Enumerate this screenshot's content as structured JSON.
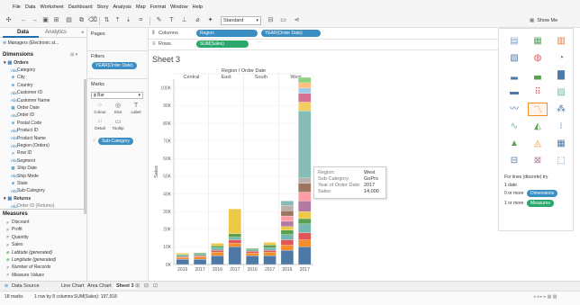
{
  "menu": [
    "File",
    "Data",
    "Worksheet",
    "Dashboard",
    "Story",
    "Analysis",
    "Map",
    "Format",
    "Window",
    "Help"
  ],
  "toolbar": {
    "fit": "Standard",
    "show_me": "Show Me"
  },
  "left_pane": {
    "tabs": [
      "Data",
      "Analytics"
    ],
    "datasource": "Managers (Electronic st...",
    "dimensions_header": "Dimensions",
    "orders_folder": "Orders",
    "dimensions": [
      "Category",
      "City",
      "Country",
      "Customer ID",
      "Customer Name",
      "Order Date",
      "Order ID",
      "Postal Code",
      "Product ID",
      "Product Name",
      "Region (Orders)",
      "Row ID",
      "Segment",
      "Ship Date",
      "Ship Mode",
      "State",
      "Sub-Category"
    ],
    "returns_folder": "Returns",
    "returns_field": "Order ID (Returns)",
    "measures_header": "Measures",
    "measures": [
      "Discount",
      "Profit",
      "Quantity",
      "Sales",
      "Latitude (generated)",
      "Longitude (generated)",
      "Number of Records",
      "Measure Values"
    ]
  },
  "mid_pane": {
    "pages": "Pages",
    "filters": "Filters",
    "filter_pill": "YEAR(Order Date)",
    "marks": "Marks",
    "mark_type": "Bar",
    "mark_buttons": [
      "Colour",
      "Size",
      "Label",
      "Detail",
      "Tooltip"
    ],
    "color_pill": "Sub-Category"
  },
  "shelves": {
    "columns_label": "Columns",
    "rows_label": "Rows",
    "columns_pills": [
      "Region",
      "YEAR(Order Date)"
    ],
    "rows_pills": [
      "SUM(Sales)"
    ]
  },
  "sheet_title": "Sheet 3",
  "tooltip": [
    {
      "key": "Region:",
      "value": "West"
    },
    {
      "key": "Sub-Category:",
      "value": "GoPro"
    },
    {
      "key": "Year of Order Date:",
      "value": "2017"
    },
    {
      "key": "Sales:",
      "value": "14,000"
    }
  ],
  "bottom_tabs": [
    "Data Source",
    "Line Chart",
    "Area Chart",
    "Sheet 3"
  ],
  "status": {
    "marks": "18 marks",
    "rows_cols": "1 row by 8 columns",
    "sum": "SUM(Sales): 197,918"
  },
  "showme": {
    "for_text": "For lines (discrete) try",
    "line1": "1 date",
    "line2": "0 or more",
    "dim_pill": "Dimensions",
    "line3": "1 or more",
    "mea_pill": "Measures"
  },
  "colors": {
    "accent": "#1f6fb0",
    "pill_blue": "#3a8ec4",
    "pill_green": "#2aa86c",
    "palette": [
      "#4e79a7",
      "#f28e2b",
      "#e15759",
      "#76b7b2",
      "#59a14f",
      "#edc948",
      "#b07aa1",
      "#ff9da7",
      "#9c755f",
      "#bab0ac",
      "#86bcb6",
      "#f1ce63",
      "#d37295",
      "#a0cbe8",
      "#ffbe7d",
      "#8cd17d",
      "#499894"
    ]
  },
  "chart_data": {
    "type": "bar",
    "title": "Region / Order Date",
    "ylabel": "Sales",
    "ylim": [
      0,
      105000
    ],
    "yticks": [
      0,
      10000,
      20000,
      30000,
      40000,
      50000,
      60000,
      70000,
      80000,
      90000,
      100000
    ],
    "ytick_labels": [
      "0K",
      "10K",
      "20K",
      "30K",
      "40K",
      "50K",
      "60K",
      "70K",
      "80K",
      "90K",
      "100K"
    ],
    "regions": [
      "Central",
      "East",
      "South",
      "West"
    ],
    "categories": [
      "2016",
      "2017",
      "2016",
      "2017",
      "2016",
      "2017",
      "2016",
      "2017"
    ],
    "bars": [
      {
        "region": "Central",
        "year": "2016",
        "segments": [
          3000,
          1000,
          500,
          800,
          500,
          700
        ]
      },
      {
        "region": "Central",
        "year": "2017",
        "segments": [
          3000,
          1500,
          500,
          800,
          700
        ]
      },
      {
        "region": "East",
        "year": "2016",
        "segments": [
          5000,
          2000,
          1000,
          1500,
          1000,
          1500
        ]
      },
      {
        "region": "East",
        "year": "2017",
        "segments": [
          10000,
          2000,
          2000,
          1500,
          2000,
          14000
        ]
      },
      {
        "region": "South",
        "year": "2016",
        "segments": [
          5000,
          1500,
          1000,
          800,
          700
        ]
      },
      {
        "region": "South",
        "year": "2017",
        "segments": [
          5000,
          2000,
          1000,
          1500,
          1500,
          1500
        ]
      },
      {
        "region": "West",
        "year": "2016",
        "segments": [
          8000,
          3000,
          3000,
          3000,
          2500,
          2000,
          3000,
          3000,
          3000,
          3000,
          2500
        ]
      },
      {
        "region": "West",
        "year": "2017",
        "segments": [
          10000,
          4000,
          4000,
          5000,
          3000,
          4000,
          6000,
          5000,
          5000,
          3000,
          38000,
          5000,
          5000,
          3000,
          3000,
          3000
        ]
      }
    ]
  }
}
